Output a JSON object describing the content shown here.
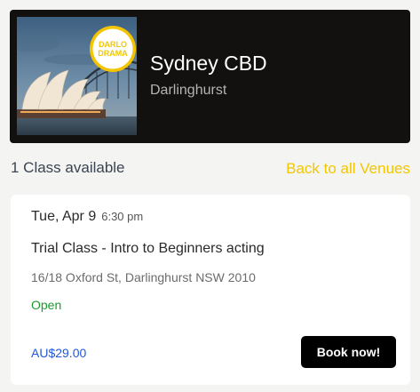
{
  "venue": {
    "name": "Sydney CBD",
    "suburb": "Darlinghurst",
    "logo_text": "DARLO DRAMA",
    "image": "sydney-opera-house-photo"
  },
  "summary": {
    "count_label": "1 Class available",
    "back_link": "Back to all Venues"
  },
  "classes": [
    {
      "date": "Tue, Apr 9",
      "time": "6:30 pm",
      "title": "Trial Class - Intro to Beginners acting",
      "address": "16/18 Oxford St, Darlinghurst NSW 2010",
      "status": "Open",
      "price": "AU$29.00",
      "book_label": "Book now!"
    }
  ],
  "colors": {
    "venue_card_bg": "#121110",
    "accent_yellow": "#f2c700",
    "status_green": "#1e9a2e",
    "price_blue": "#2458d6",
    "button_bg": "#000000"
  }
}
